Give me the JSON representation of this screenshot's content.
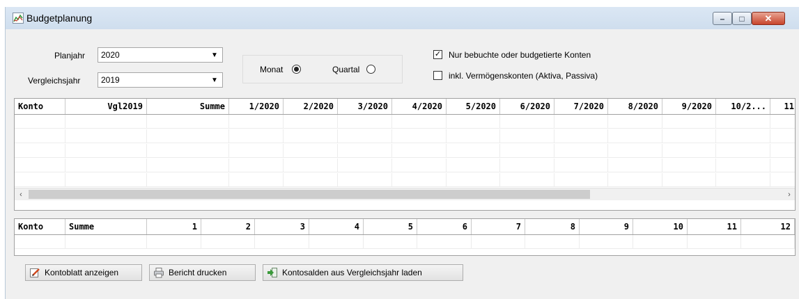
{
  "window": {
    "title": "Budgetplanung",
    "minimize": "–",
    "maximize": "□",
    "close": "✕"
  },
  "form": {
    "planjahr_label": "Planjahr",
    "planjahr_value": "2020",
    "vergleichsjahr_label": "Vergleichsjahr",
    "vergleichsjahr_value": "2019",
    "monat_label": "Monat",
    "quartal_label": "Quartal",
    "period_selected": "Monat",
    "nur_bebuchte_label": "Nur bebuchte oder budgetierte Konten",
    "nur_bebuchte_checked": true,
    "inkl_vermoegen_label": "inkl. Vermögenskonten (Aktiva, Passiva)",
    "inkl_vermoegen_checked": false
  },
  "top_grid": {
    "columns": [
      "Konto",
      "Vgl2019",
      "Summe",
      "1/2020",
      "2/2020",
      "3/2020",
      "4/2020",
      "5/2020",
      "6/2020",
      "7/2020",
      "8/2020",
      "9/2020",
      "10/2...",
      "11"
    ]
  },
  "bottom_grid": {
    "columns": [
      "Konto",
      "Summe",
      "1",
      "2",
      "3",
      "4",
      "5",
      "6",
      "7",
      "8",
      "9",
      "10",
      "11",
      "12"
    ]
  },
  "scrollbar": {
    "left_arrow": "‹",
    "right_arrow": "›"
  },
  "buttons": {
    "kontoblatt": "Kontoblatt anzeigen",
    "bericht": "Bericht drucken",
    "kontosalden": "Kontosalden aus Vergleichsjahr laden"
  },
  "colors": {
    "titlebar": "#cfdeee",
    "close_button": "#c8452c",
    "window_bg": "#f0f0f0"
  }
}
